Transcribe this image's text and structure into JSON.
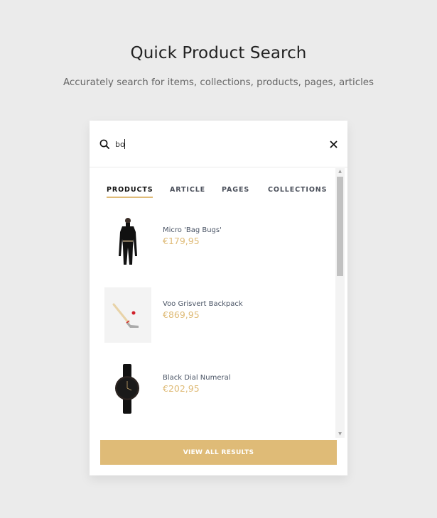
{
  "header": {
    "title": "Quick Product Search",
    "subtitle": "Accurately search for items, collections, products, pages, articles"
  },
  "search": {
    "value": "bo",
    "icon": "search-icon",
    "close_icon": "close-icon"
  },
  "tabs": [
    {
      "label": "PRODUCTS",
      "active": true
    },
    {
      "label": "ARTICLE",
      "active": false
    },
    {
      "label": "PAGES",
      "active": false
    },
    {
      "label": "COLLECTIONS",
      "active": false
    }
  ],
  "products": [
    {
      "name": "Micro 'Bag Bugs'",
      "price": "€179,95",
      "image": "woman-black-outfit"
    },
    {
      "name": "Voo Grisvert Backpack",
      "price": "€869,95",
      "image": "hockey-stick"
    },
    {
      "name": "Black Dial Numeral",
      "price": "€202,95",
      "image": "black-watch"
    }
  ],
  "actions": {
    "view_all_label": "VIEW ALL RESULTS"
  },
  "colors": {
    "accent": "#dfbb77",
    "background": "#ebebeb"
  }
}
